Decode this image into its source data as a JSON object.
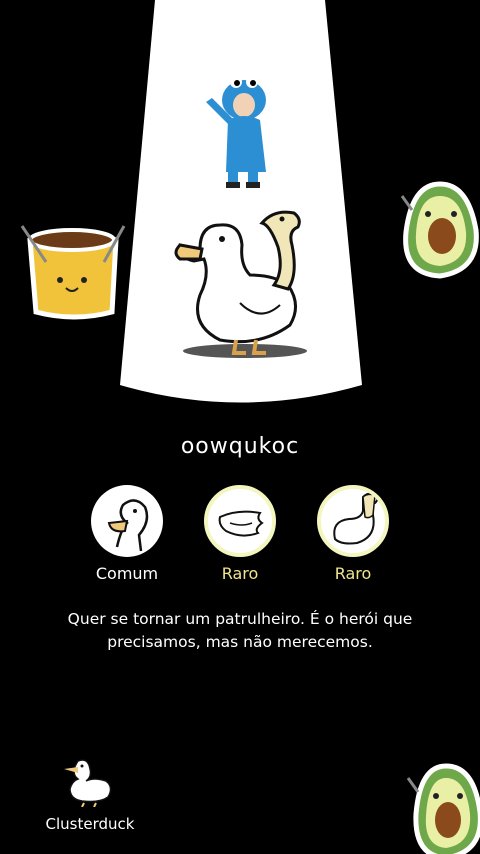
{
  "duck": {
    "name": "oowqukoc",
    "description": "Quer se tornar um patrulheiro. É o herói que precisamos, mas não merecemos."
  },
  "parts": [
    {
      "rarity": "Comum",
      "icon": "duck-head-icon",
      "color": "#ffffff"
    },
    {
      "rarity": "Raro",
      "icon": "wing-icon",
      "color": "#f0e68c"
    },
    {
      "rarity": "Raro",
      "icon": "snake-neck-icon",
      "color": "#f0e68c"
    }
  ],
  "brand": {
    "label": "Clusterduck",
    "icon": "duck-logo-icon"
  },
  "stickers": [
    "pudding-sticker",
    "avocado-sticker",
    "cookie-monster-baby-sticker"
  ]
}
